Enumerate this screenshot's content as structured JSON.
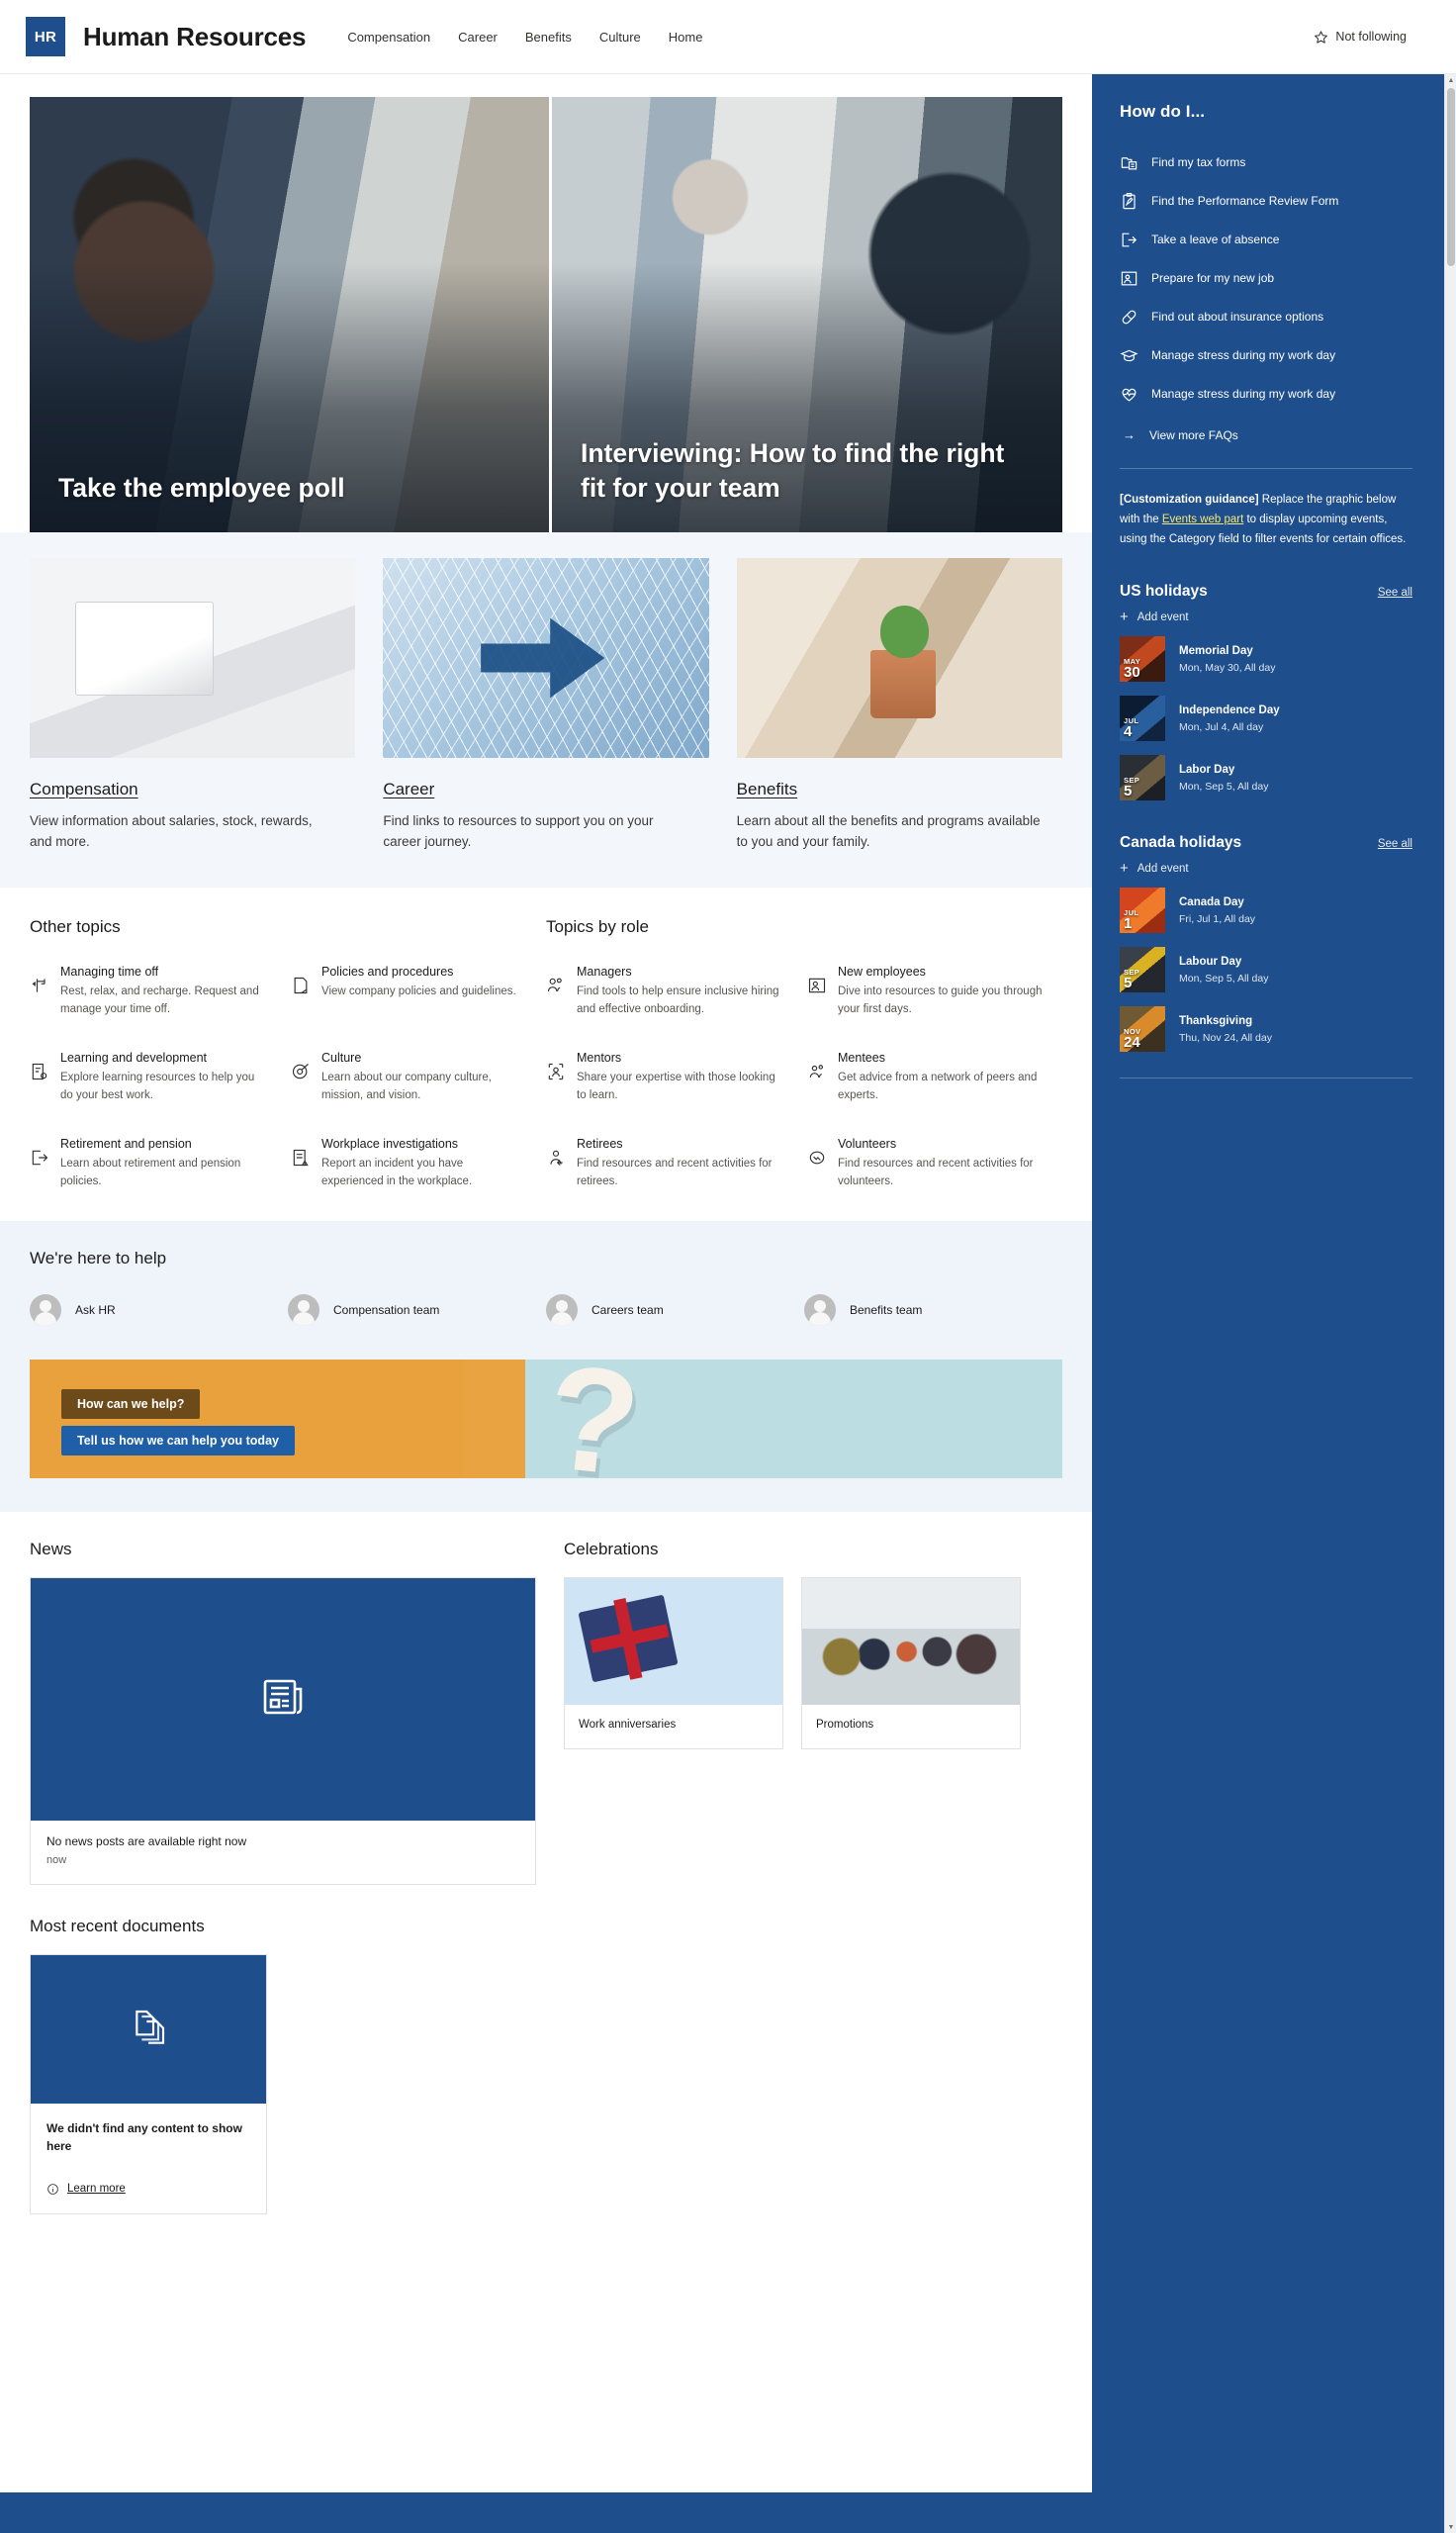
{
  "header": {
    "logo_text": "HR",
    "site_title": "Human Resources",
    "nav": [
      {
        "label": "Compensation"
      },
      {
        "label": "Career"
      },
      {
        "label": "Benefits"
      },
      {
        "label": "Culture"
      },
      {
        "label": "Home"
      }
    ],
    "follow_label": "Not following",
    "follow_icon": "star-icon"
  },
  "hero": {
    "tiles": [
      {
        "title": "Take the employee poll",
        "image": "woman-at-laptop-office"
      },
      {
        "title": "Interviewing: How to find the right fit for your team",
        "image": "interview-meeting"
      }
    ]
  },
  "link_cards": [
    {
      "title": "Compensation",
      "description": "View information about salaries, stock, rewards, and more.",
      "image": "calculator-on-desk"
    },
    {
      "title": "Career",
      "description": "Find links to resources to support you on your career journey.",
      "image": "blue-arrow-network"
    },
    {
      "title": "Benefits",
      "description": "Learn about all the benefits and programs available to you and your family.",
      "image": "hands-holding-plant"
    }
  ],
  "other_topics": {
    "title": "Other topics",
    "items": [
      {
        "name": "Managing time off",
        "description": "Rest, relax, and recharge. Request and manage your time off.",
        "icon": "time-off-icon"
      },
      {
        "name": "Policies and procedures",
        "description": "View company policies and guidelines.",
        "icon": "document-icon"
      },
      {
        "name": "Learning and development",
        "description": "Explore learning resources to help you do your best work.",
        "icon": "learning-icon"
      },
      {
        "name": "Culture",
        "description": "Learn about our company culture, mission, and vision.",
        "icon": "target-pen-icon"
      },
      {
        "name": "Retirement and pension",
        "description": "Learn about retirement and pension policies.",
        "icon": "exit-arrow-icon"
      },
      {
        "name": "Workplace investigations",
        "description": "Report an incident you have experienced in the workplace.",
        "icon": "report-warning-icon"
      }
    ]
  },
  "topics_by_role": {
    "title": "Topics by role",
    "items": [
      {
        "name": "Managers",
        "description": "Find tools to help ensure inclusive hiring and effective onboarding.",
        "icon": "people-icon"
      },
      {
        "name": "New employees",
        "description": "Dive into resources to guide you through your first days.",
        "icon": "new-hire-icon"
      },
      {
        "name": "Mentors",
        "description": "Share your expertise with those looking to learn.",
        "icon": "person-box-icon"
      },
      {
        "name": "Mentees",
        "description": "Get advice from a network of peers and experts.",
        "icon": "two-people-icon"
      },
      {
        "name": "Retirees",
        "description": "Find resources and recent activities for retirees.",
        "icon": "person-leave-icon"
      },
      {
        "name": "Volunteers",
        "description": "Find resources and recent activities for volunteers.",
        "icon": "handshake-icon"
      }
    ]
  },
  "help": {
    "title": "We're here to help",
    "people": [
      {
        "name": "Ask HR",
        "icon": "avatar"
      },
      {
        "name": "Compensation team",
        "icon": "avatar"
      },
      {
        "name": "Careers team",
        "icon": "avatar"
      },
      {
        "name": "Benefits team",
        "icon": "avatar"
      }
    ]
  },
  "promo": {
    "button_primary": "How can we help?",
    "button_secondary": "Tell us how we can help you today",
    "graphic": "question-mark-banner",
    "colors": {
      "left": "#e8a13c",
      "right": "#bcdde2",
      "brown": "#6d4a1a",
      "blue": "#1e5fa8"
    }
  },
  "news": {
    "title": "News",
    "thumb_icon": "news-icon",
    "empty_title": "No news posts are available right now",
    "empty_meta": "now"
  },
  "celebrations": {
    "title": "Celebrations",
    "cards": [
      {
        "label": "Work anniversaries",
        "image": "blue-gift-box"
      },
      {
        "label": "Promotions",
        "image": "team-applauding"
      }
    ]
  },
  "documents": {
    "title": "Most recent documents",
    "thumb_icon": "documents-icon",
    "empty_title": "We didn't find any content to show here",
    "learn_more": "Learn more",
    "learn_more_icon": "info-icon"
  },
  "rail": {
    "how_do_i": {
      "title": "How do I...",
      "items": [
        {
          "label": "Find my tax forms",
          "icon": "tax-form-icon"
        },
        {
          "label": "Find the Performance Review Form",
          "icon": "clipboard-edit-icon"
        },
        {
          "label": "Take a leave of absence",
          "icon": "sign-out-icon"
        },
        {
          "label": "Prepare for my new job",
          "icon": "new-job-icon"
        },
        {
          "label": "Find out about insurance options",
          "icon": "pill-icon"
        },
        {
          "label": "Manage stress during my work day",
          "icon": "graduation-cap-icon"
        },
        {
          "label": "Manage stress during my work day",
          "icon": "heart-pulse-icon"
        }
      ],
      "view_more": "View more FAQs",
      "view_more_icon": "arrow-right-icon"
    },
    "guidance": {
      "bold_prefix": "[Customization guidance]",
      "text_before": " Replace the graphic below with the ",
      "link": "Events web part",
      "text_after": " to display upcoming events, using the Category field to filter events for certain offices."
    },
    "calendars": [
      {
        "title": "US holidays",
        "see_all": "See all",
        "add_event": "Add event",
        "events": [
          {
            "month": "MAY",
            "day": "30",
            "name": "Memorial Day",
            "when": "Mon, May 30, All day",
            "image": "memorial-day-photo"
          },
          {
            "month": "JUL",
            "day": "4",
            "name": "Independence Day",
            "when": "Mon, Jul 4, All day",
            "image": "fireworks-photo"
          },
          {
            "month": "SEP",
            "day": "5",
            "name": "Labor Day",
            "when": "Mon, Sep 5, All day",
            "image": "labor-day-photo"
          }
        ]
      },
      {
        "title": "Canada holidays",
        "see_all": "See all",
        "add_event": "Add event",
        "events": [
          {
            "month": "JUL",
            "day": "1",
            "name": "Canada Day",
            "when": "Fri, Jul 1, All day",
            "image": "maple-leaves-photo"
          },
          {
            "month": "SEP",
            "day": "5",
            "name": "Labour Day",
            "when": "Mon, Sep 5, All day",
            "image": "worker-photo"
          },
          {
            "month": "NOV",
            "day": "24",
            "name": "Thanksgiving",
            "when": "Thu, Nov 24, All day",
            "image": "pumpkins-photo"
          }
        ]
      }
    ]
  },
  "colors": {
    "brand_blue": "#1e4e8c",
    "band_light": "#f3f7fb",
    "band_help": "#eef4fa"
  }
}
